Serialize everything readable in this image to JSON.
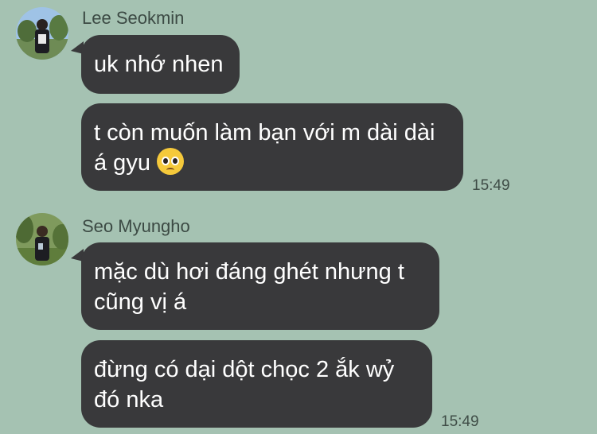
{
  "messages": [
    {
      "sender": "Lee Seokmin",
      "bubbles": [
        {
          "text": "uk nhớ nhen"
        },
        {
          "line1": "t còn muốn làm bạn với m dài dài",
          "line2": "á gyu",
          "emoji": "pleading-face-icon",
          "time": "15:49"
        }
      ]
    },
    {
      "sender": "Seo Myungho",
      "bubbles": [
        {
          "line1": "mặc dù hơi đáng ghét nhưng t",
          "line2": "cũng vị á"
        },
        {
          "line1": "đừng có dại dột chọc 2 ắk wỷ",
          "line2": "đó nka",
          "time": "15:49"
        }
      ]
    }
  ],
  "colors": {
    "background": "#a5c2b2",
    "bubble": "#39393b",
    "bubble_text": "#ffffff",
    "meta_text": "#3f4d47",
    "emoji": "#f5c93b"
  }
}
